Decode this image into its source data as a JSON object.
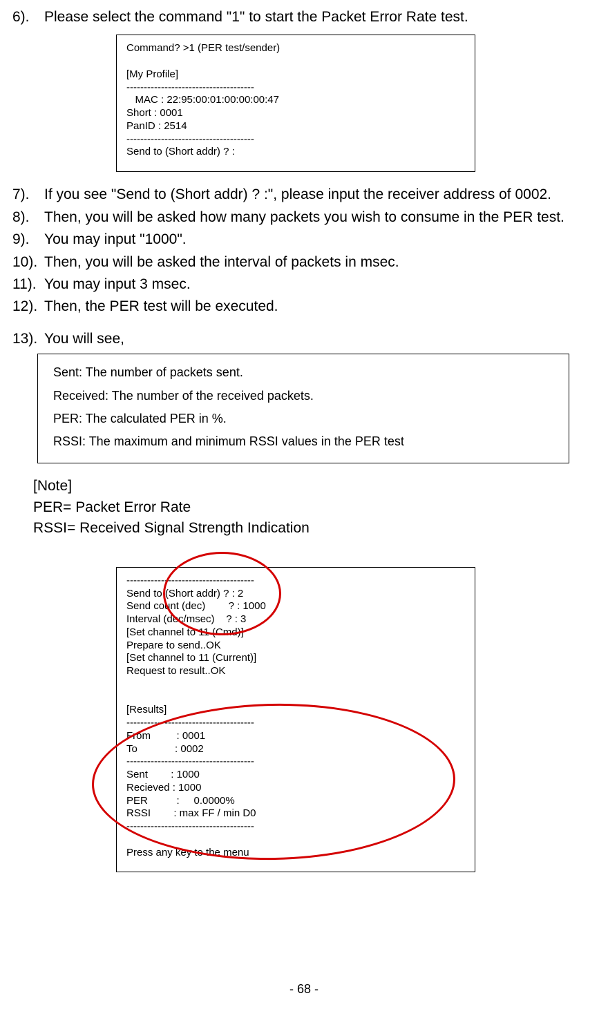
{
  "steps": {
    "s6": {
      "num": "6).",
      "txt": "Please select the command \"1\" to start the Packet Error Rate test."
    },
    "s7": {
      "num": "7).",
      "txt": "If you see \"Send to (Short addr) ? :\", please input the receiver address of 0002."
    },
    "s8": {
      "num": "8).",
      "txt": "Then, you will be asked how many packets you wish to consume in the PER test."
    },
    "s9": {
      "num": "9).",
      "txt": "You may input \"1000\"."
    },
    "s10": {
      "num": "10).",
      "txt": "Then, you will be asked the interval of packets in msec."
    },
    "s11": {
      "num": "11).",
      "txt": "You may input 3 msec."
    },
    "s12": {
      "num": "12).",
      "txt": "Then, the PER test will be executed."
    },
    "s13": {
      "num": "13).",
      "txt": "You will see,"
    }
  },
  "code1": "Command? >1 (PER test/sender)\n\n[My Profile]\n-------------------------------------\n   MAC : 22:95:00:01:00:00:00:47\nShort : 0001\nPanID : 2514\n-------------------------------------\nSend to (Short addr) ? :",
  "legend": {
    "l1": "Sent: The number of packets sent.",
    "l2": "Received: The number of the received packets.",
    "l3": "PER: The calculated PER in %.",
    "l4": "RSSI: The maximum and minimum RSSI values in the PER test"
  },
  "note": {
    "title": "[Note]",
    "line1": "PER= Packet Error Rate",
    "line2": "RSSI= Received Signal Strength Indication"
  },
  "code2": "-------------------------------------\nSend to (Short addr) ? : 2\nSend count (dec)        ? : 1000\nInterval (dec/msec)    ? : 3\n[Set channel to 11 (Cmd)]\nPrepare to send..OK\n[Set channel to 11 (Current)]\nRequest to result..OK\n\n\n[Results]\n-------------------------------------\nFrom         : 0001\nTo             : 0002\n-------------------------------------\nSent        : 1000\nRecieved : 1000\nPER          :     0.0000%\nRSSI        : max FF / min D0\n-------------------------------------\n\nPress any key to the menu",
  "page_number": "- 68 -",
  "chart_data": {
    "type": "table",
    "title": "PER Test Parameters and Results",
    "parameters": {
      "Send to (Short addr)": "2",
      "Send count (dec)": "1000",
      "Interval (dec/msec)": "3",
      "Set channel": "11"
    },
    "results": {
      "From": "0001",
      "To": "0002",
      "Sent": 1000,
      "Recieved": 1000,
      "PER_percent": 0.0,
      "RSSI_max": "FF",
      "RSSI_min": "D0"
    },
    "profile": {
      "MAC": "22:95:00:01:00:00:00:47",
      "Short": "0001",
      "PanID": "2514"
    }
  }
}
